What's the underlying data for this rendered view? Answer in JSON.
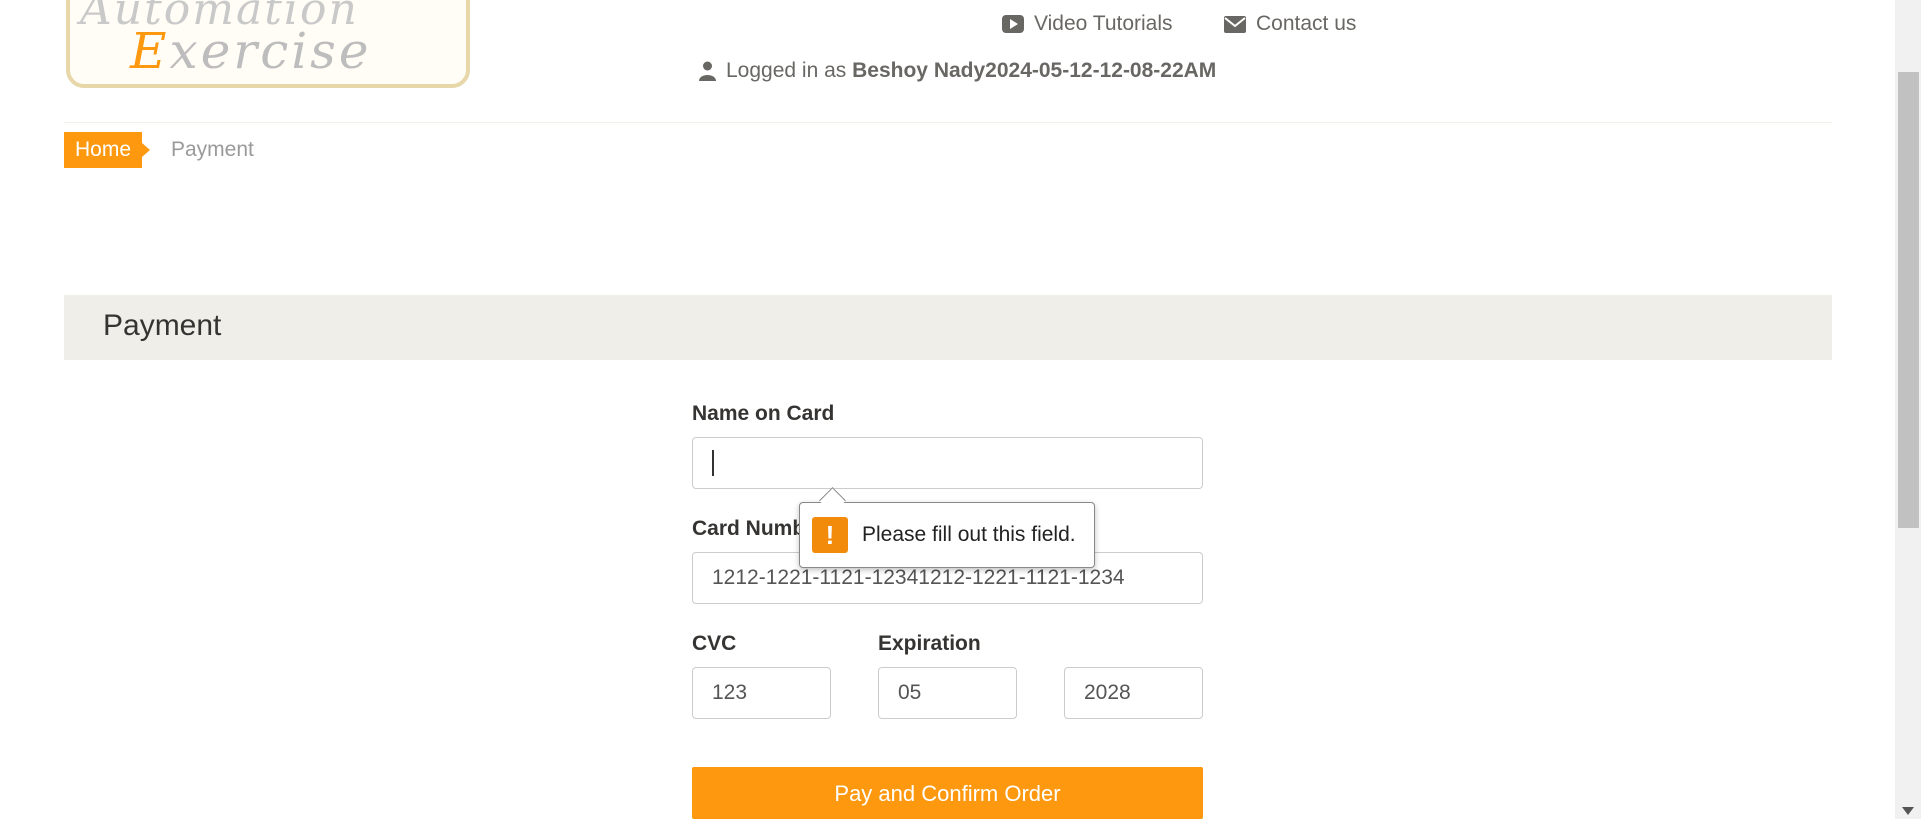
{
  "logo": {
    "line1": "Automation",
    "line2_accent": "E",
    "line2_rest": "xercise"
  },
  "header": {
    "video_tutorials": "Video Tutorials",
    "contact_us": "Contact us",
    "logged_in_prefix": "Logged in as",
    "username": "Beshoy Nady2024-05-12-12-08-22AM"
  },
  "breadcrumb": {
    "home": "Home",
    "current": "Payment"
  },
  "payment": {
    "title": "Payment",
    "name_on_card_label": "Name on Card",
    "name_on_card_value": "",
    "card_number_label": "Card Number",
    "card_number_value": "1212-1221-1121-12341212-1221-1121-1234",
    "cvc_label": "CVC",
    "cvc_value": "123",
    "expiration_label": "Expiration",
    "exp_month_value": "05",
    "exp_year_value": "2028",
    "submit_label": "Pay and Confirm Order"
  },
  "validation": {
    "message": "Please fill out this field.",
    "icon": "!"
  },
  "colors": {
    "accent": "#fe980f",
    "band": "#efeee9"
  }
}
